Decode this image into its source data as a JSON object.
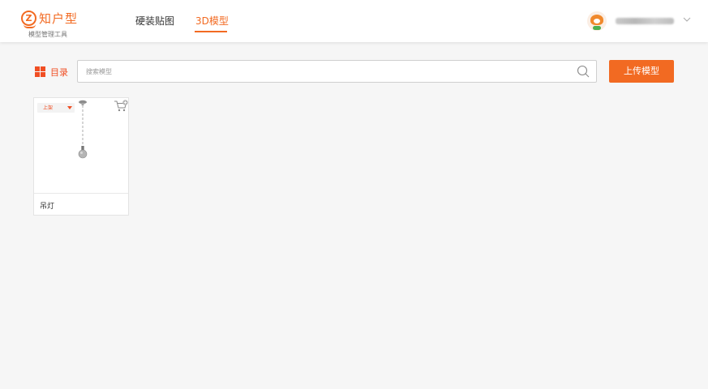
{
  "brand": {
    "name": "知户型",
    "subtitle": "模型管理工具",
    "accent_color": "#f26a22"
  },
  "nav": {
    "items": [
      {
        "label": "硬装贴图",
        "active": false
      },
      {
        "label": "3D模型",
        "active": true
      }
    ]
  },
  "user": {
    "avatar_icon": "fox-avatar-icon",
    "name_obscured": true,
    "menu_icon": "chevron-down-icon"
  },
  "toolbar": {
    "catalog_label": "目录",
    "catalog_icon": "grid-icon",
    "search_placeholder": "搜索模型",
    "search_value": "",
    "upload_label": "上传模型"
  },
  "models": [
    {
      "name": "吊灯",
      "status": "上架",
      "thumbnail": "pendant-lamp",
      "cart_icon": "cart-add-icon"
    }
  ]
}
